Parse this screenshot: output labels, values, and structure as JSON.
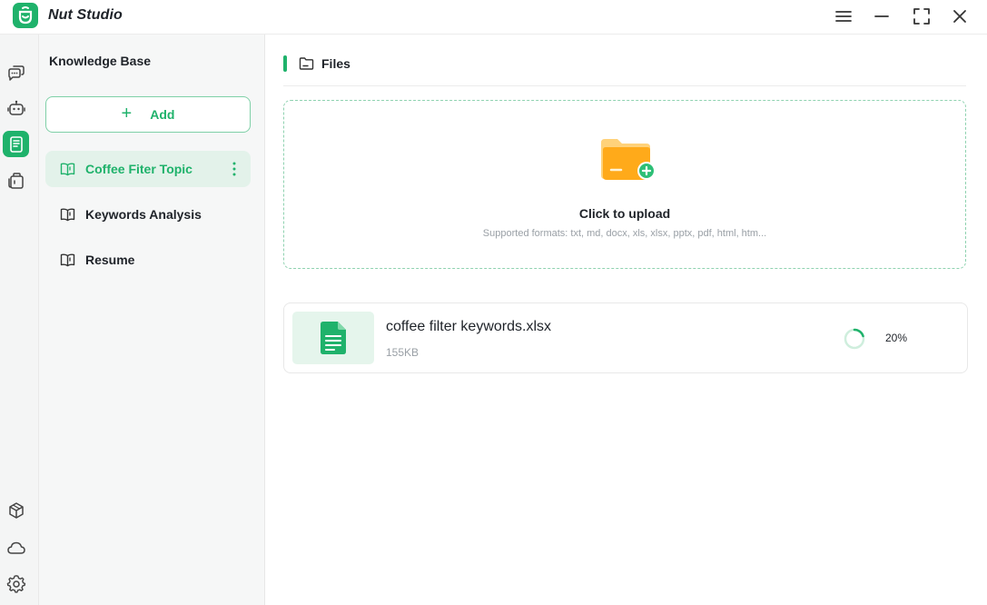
{
  "app": {
    "title": "Nut Studio"
  },
  "sidebar": {
    "title": "Knowledge Base",
    "add_label": "Add",
    "items": [
      {
        "label": "Coffee Fiter Topic",
        "active": true
      },
      {
        "label": "Keywords Analysis",
        "active": false
      },
      {
        "label": "Resume",
        "active": false
      }
    ]
  },
  "main": {
    "section_title": "Files",
    "upload": {
      "title": "Click to upload",
      "formats": "Supported formats: txt, md, docx, xls, xlsx, pptx, pdf, html, htm..."
    },
    "files": [
      {
        "name": "coffee filter keywords.xlsx",
        "size": "155KB",
        "progress_text": "20%",
        "progress": 0.2
      }
    ]
  },
  "icons": {
    "titlebar": [
      "app-logo-icon",
      "menu-icon",
      "minimize-icon",
      "maximize-icon",
      "close-icon"
    ],
    "rail_top": [
      "chat-icon",
      "robot-icon",
      "knowledge-base-icon",
      "toolbox-icon"
    ],
    "rail_bottom": [
      "package-icon",
      "cloud-icon",
      "settings-icon"
    ]
  },
  "colors": {
    "accent": "#1fb26b",
    "accent_light": "#e3f2ea",
    "folder": "#ffb020"
  }
}
